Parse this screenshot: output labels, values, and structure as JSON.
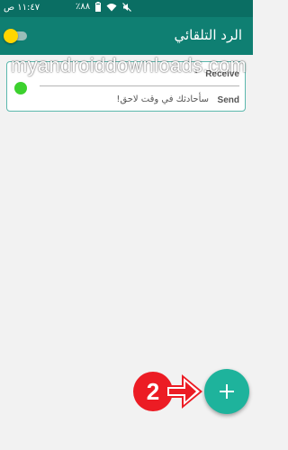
{
  "status_bar": {
    "time": "١١:٤٧ ص",
    "battery": "٪٨٨",
    "icons": [
      "battery-icon",
      "wifi-icon",
      "mute-icon"
    ]
  },
  "app_bar": {
    "title": "الرد التلقائي",
    "toggle": {
      "on": true,
      "thumb_color": "#ffd600"
    }
  },
  "watermark": "myandroiddownloads.com",
  "reply_card": {
    "receive_label": "Receive",
    "receive_value": "*",
    "send_label": "Send",
    "send_value": "سأحادثك في وقت لاحق!",
    "status_color": "#3cd12e"
  },
  "annotation": {
    "step": "2",
    "color": "#ec1c24"
  },
  "fab": {
    "icon": "plus-icon",
    "color": "#1eb39c"
  },
  "colors": {
    "status_bar": "#0a6e63",
    "app_bar": "#0f7f72",
    "background": "#f2f2f2",
    "card_border": "#5cb8ad"
  }
}
